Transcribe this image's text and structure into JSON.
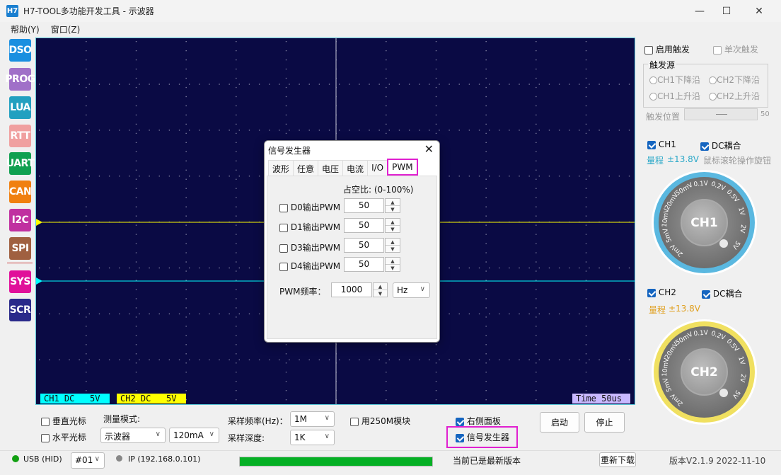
{
  "window": {
    "icon_text": "H7",
    "title": "H7-TOOL多功能开发工具 - 示波器",
    "min": "—",
    "max": "☐",
    "close": "✕"
  },
  "menu": [
    "帮助(Y)",
    "窗口(Z)"
  ],
  "sidebar": [
    {
      "label": "DSO",
      "color": "#1a8fe0"
    },
    {
      "label": "PROG",
      "color": "#a070c8"
    },
    {
      "label": "LUA",
      "color": "#22a0c0"
    },
    {
      "label": "RTT",
      "color": "#f0a0a0"
    },
    {
      "label": "UART",
      "color": "#10a050"
    },
    {
      "label": "CAN",
      "color": "#f08010"
    },
    {
      "label": "I2C",
      "color": "#c030a0"
    },
    {
      "label": "SPI",
      "color": "#a06040"
    },
    {
      "label": "SYS",
      "color": "#e0109a"
    },
    {
      "label": "SCR",
      "color": "#2a2a8a"
    }
  ],
  "scope": {
    "ch1_label": "CH1 DC   5V",
    "ch2_label": "CH2 DC   5V",
    "time_label": "Time 50us",
    "background": "#0a0a44",
    "ch1_color": "#ffff00",
    "ch2_color": "#00ffff"
  },
  "trigger": {
    "enable_label": "启用触发",
    "single_label": "单次触发",
    "source_title": "触发源",
    "sources": [
      "CH1下降沿",
      "CH2下降沿",
      "CH1上升沿",
      "CH2上升沿"
    ],
    "position_label": "触发位置",
    "position_value": "50"
  },
  "ch1": {
    "enable_label": "CH1",
    "dc_label": "DC耦合",
    "range_label": "量程",
    "range_value": "±13.8V",
    "hint": "鼠标滚轮操作旋钮",
    "knob_label": "CH1",
    "ring_color": "#5ab8e0"
  },
  "ch2": {
    "enable_label": "CH2",
    "dc_label": "DC耦合",
    "range_label": "量程",
    "range_value": "±13.8V",
    "knob_label": "CH2",
    "ring_color": "#f0e060"
  },
  "knob_scale": [
    "2mV",
    "5mV",
    "10mV",
    "20mV",
    "50mV",
    "0.1V",
    "0.2V",
    "0.5V",
    "1V",
    "2V",
    "5V"
  ],
  "dialog": {
    "title": "信号发生器",
    "close": "✕",
    "tabs": [
      "波形",
      "任意",
      "电压",
      "电流",
      "I/O",
      "PWM"
    ],
    "duty_label": "占空比: (0-100%)",
    "outputs": [
      {
        "label": "D0输出PWM",
        "value": "50"
      },
      {
        "label": "D1输出PWM",
        "value": "50"
      },
      {
        "label": "D3输出PWM",
        "value": "50"
      },
      {
        "label": "D4输出PWM",
        "value": "50"
      }
    ],
    "freq_label": "PWM频率：",
    "freq_value": "1000",
    "freq_unit": "Hz"
  },
  "bottom": {
    "vcursor_label": "垂直光标",
    "hcursor_label": "水平光标",
    "mode_title": "测量模式:",
    "mode_value": "示波器",
    "current_value": "120mA",
    "rate_label": "采样频率(Hz)：",
    "rate_value": "1M",
    "depth_label": "采样深度:",
    "depth_value": "1K",
    "module_label": "用250M模块",
    "right_panel_label": "右侧面板",
    "siggen_label": "信号发生器",
    "start_label": "启动",
    "stop_label": "停止"
  },
  "status": {
    "usb": "USB (HID)",
    "device": "#01",
    "ip": "IP (192.168.0.101)",
    "progress": 1.0,
    "version_msg": "当前已是最新版本",
    "redownload": "重新下载",
    "version": "版本V2.1.9 2022-11-10"
  }
}
